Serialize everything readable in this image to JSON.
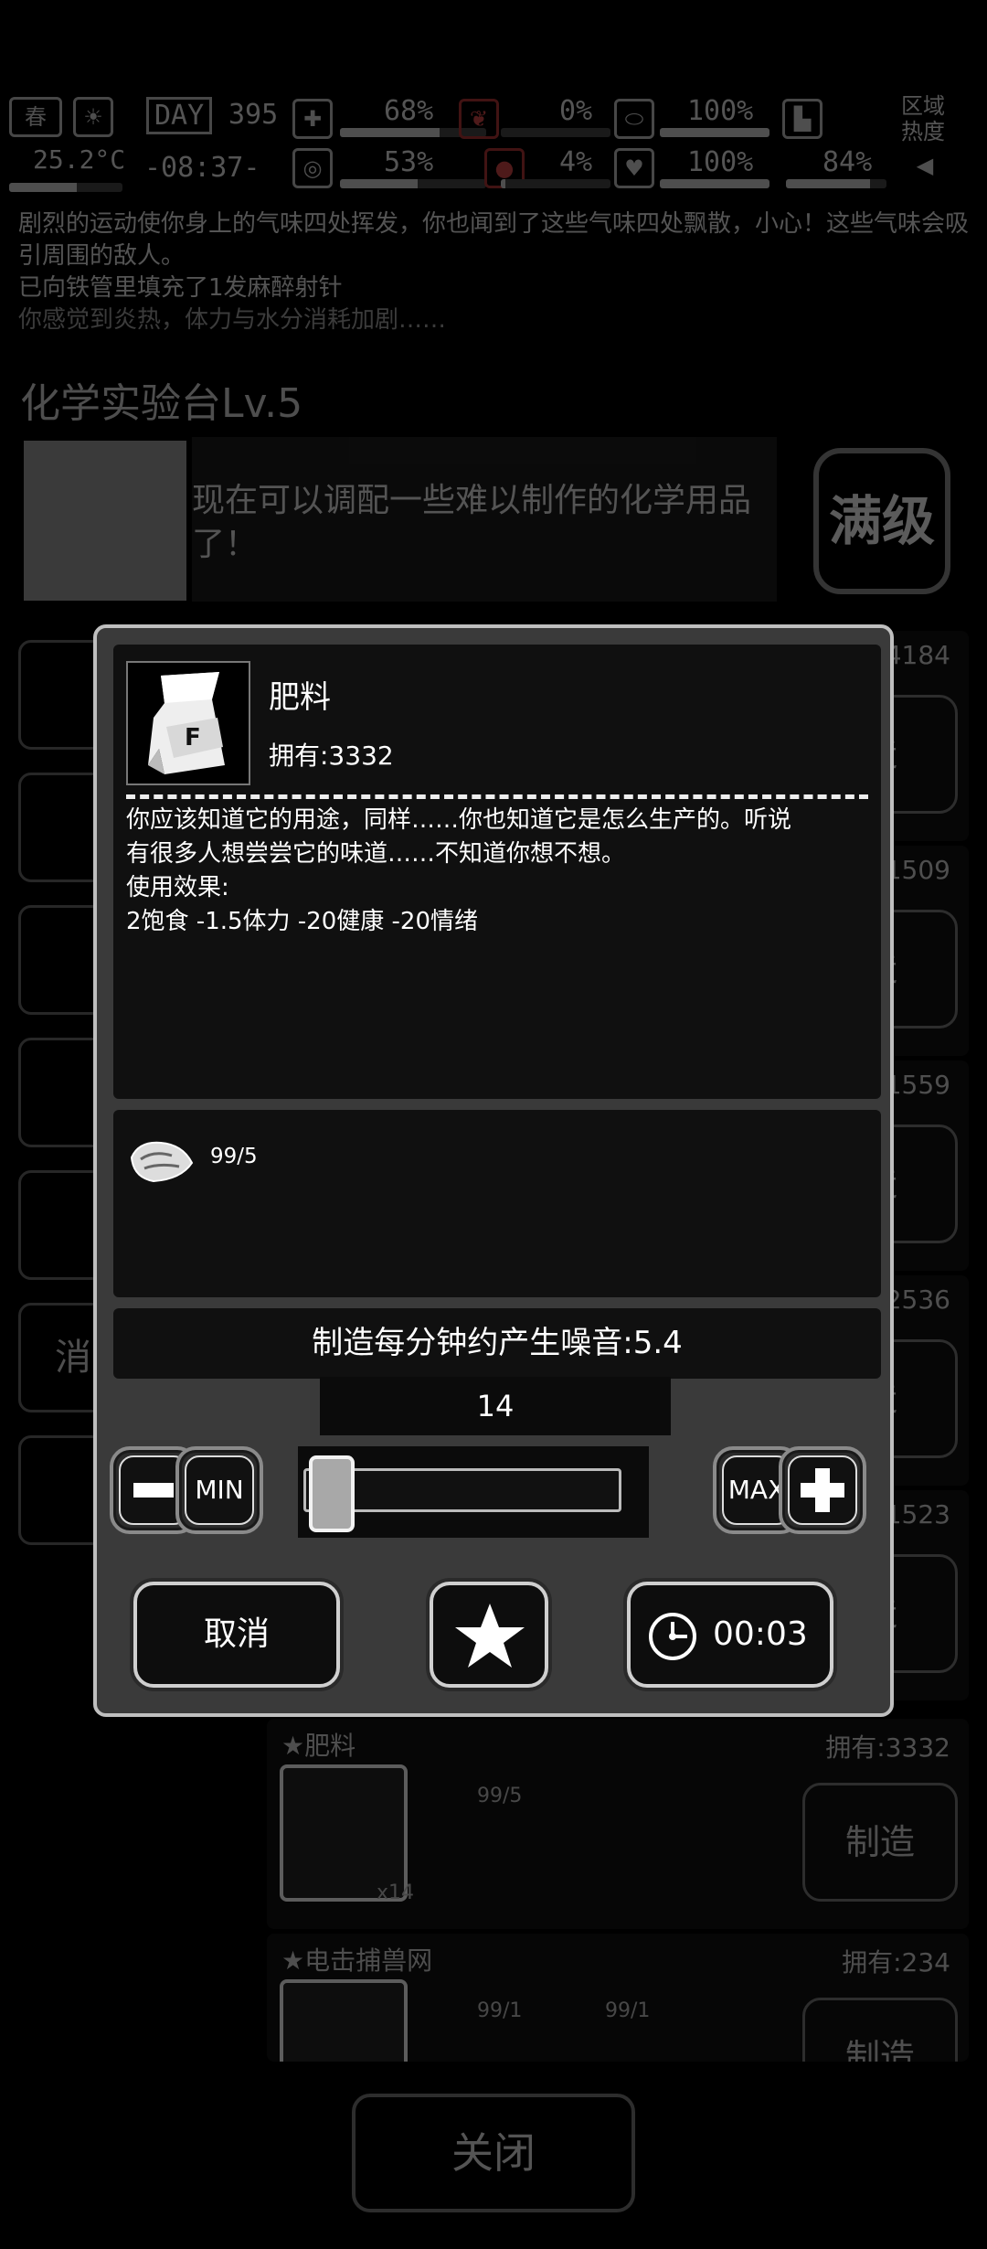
{
  "status": {
    "season": "春",
    "temperature": "25.2°C",
    "day_label": "DAY",
    "day": "395",
    "time": "-08:37-",
    "health_pct": "68%",
    "hunger_pct": "53%",
    "stat3_pct": "0%",
    "stat4_pct": "4%",
    "stat5_pct": "100%",
    "stat6_pct": "100%",
    "stamina_pct": "84%",
    "region_heat": "区域热度"
  },
  "log": [
    "剧烈的运动使你身上的气味四处挥发，你也闻到了这些气味四处飘散，小心！这些气味会吸引周围的敌人。",
    "已向铁管里填充了1发麻醉射针",
    "你感觉到炎热，体力与水分消耗加剧……"
  ],
  "bench": {
    "title": "化学实验台Lv.5",
    "desc": "现在可以调配一些难以制作的化学用品了！",
    "badge": "满级"
  },
  "left_tabs": [
    "",
    "",
    "",
    "",
    "",
    "消",
    ""
  ],
  "recipes": [
    {
      "own": ":4184",
      "make": "造"
    },
    {
      "own": ":1509",
      "make": "造"
    },
    {
      "own": ":1559",
      "make": "造"
    },
    {
      "own": ":2536",
      "make": "造"
    },
    {
      "own": ":1523",
      "make": "造"
    },
    {
      "name": "肥料",
      "own": "拥有:3332",
      "mat_qty": "99/5",
      "count": "x14",
      "make": "制造"
    },
    {
      "name": "电击捕兽网",
      "own": "拥有:234",
      "mat1_qty": "99/1",
      "mat2_qty": "99/1",
      "make": "制造"
    }
  ],
  "close_label": "关闭",
  "dialog": {
    "item_name": "肥料",
    "item_own": "拥有:3332",
    "desc_lines": [
      "你应该知道它的用途，同样……你也知道它是怎么生产的。听说",
      "有很多人想尝尝它的味道……不知道你想不想。",
      "使用效果:",
      "2饱食 -1.5体力 -20健康 -20情绪"
    ],
    "material_qty": "99/5",
    "noise_text": "制造每分钟约产生噪音:5.4",
    "quantity": "14",
    "slider_value": 14,
    "slider_max": 99,
    "min_label": "MIN",
    "max_label": "MAX",
    "cancel_label": "取消",
    "timer_label": "00:03"
  }
}
